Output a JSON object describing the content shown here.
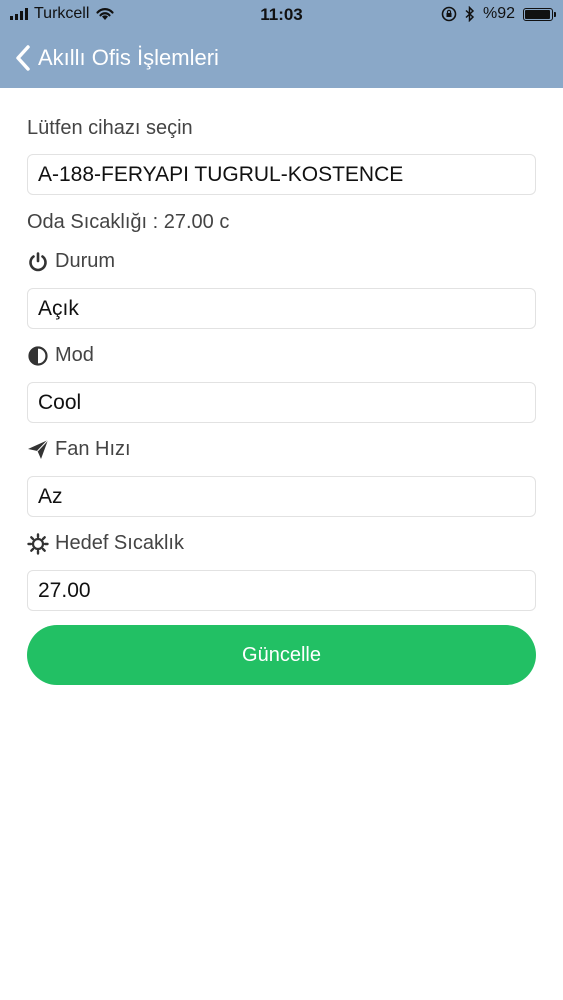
{
  "status_bar": {
    "carrier": "Turkcell",
    "time": "11:03",
    "battery_text": "%92"
  },
  "nav": {
    "back_title": "Akıllı Ofis  İşlemleri"
  },
  "form": {
    "device_prompt": "Lütfen cihazı seçin",
    "device_value": "A-188-FERYAPI TUGRUL-KOSTENCE",
    "room_temp": "Oda Sıcaklığı : 27.00 c",
    "durum_label": "Durum",
    "durum_value": "Açık",
    "mod_label": "Mod",
    "mod_value": "Cool",
    "fan_label": "Fan Hızı",
    "fan_value": "Az",
    "target_label": "Hedef Sıcaklık",
    "target_value": "27.00",
    "update_button": "Güncelle"
  },
  "colors": {
    "header_bg": "#8aa8c8",
    "button_green": "#22c064"
  },
  "icons": {
    "durum": "power-icon",
    "mod": "contrast-icon",
    "fan": "paper-plane-icon",
    "target": "gear-icon"
  }
}
